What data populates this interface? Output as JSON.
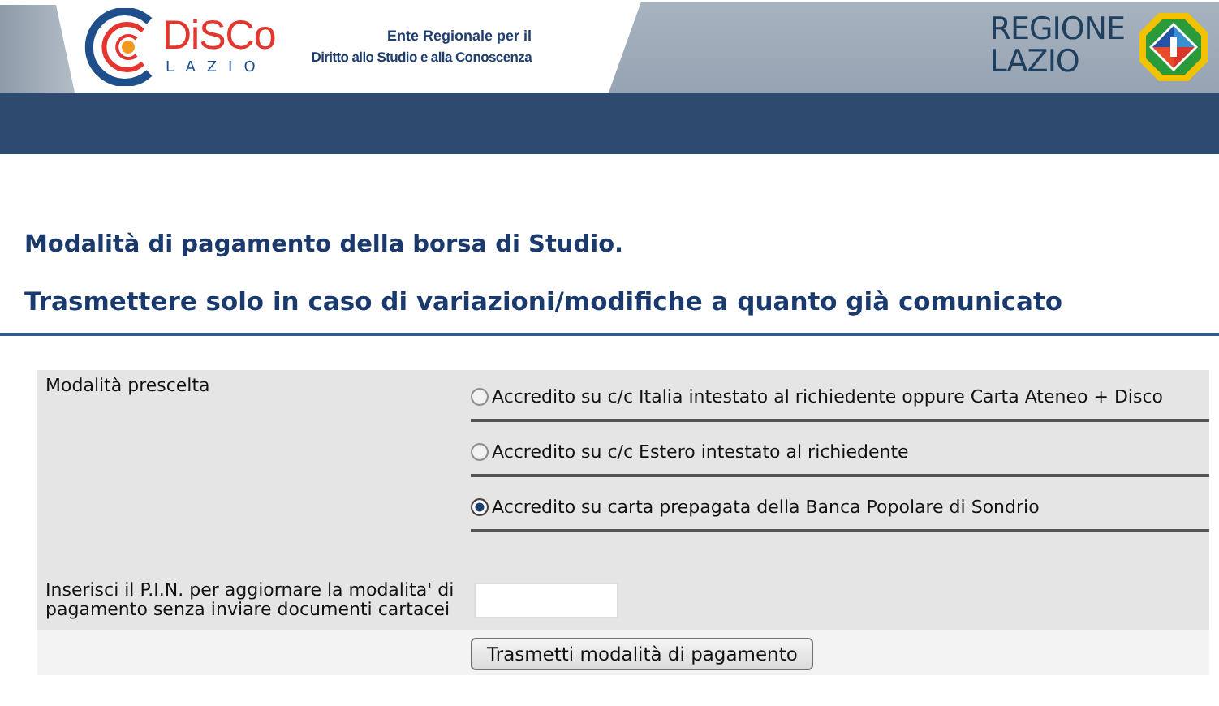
{
  "header": {
    "logo_name": "DiSCo",
    "logo_sub": "LAZIO",
    "tagline": "Ente Regionale per il",
    "tagline_2": "Diritto allo Studio e alla Conoscenza",
    "region": [
      "REGIONE",
      "LAZIO"
    ]
  },
  "titles": [
    "Modalità di pagamento della borsa di Studio.",
    "Trasmettere solo in caso di variazioni/modifiche a quanto già comunicato"
  ],
  "form": {
    "choice_label": "Modalità prescelta",
    "options": [
      {
        "label": "Accredito su c/c Italia intestato al richiedente oppure Carta Ateneo + Disco",
        "selected": false
      },
      {
        "label": "Accredito su c/c Estero intestato al richiedente",
        "selected": false
      },
      {
        "label": "Accredito su carta prepagata della Banca Popolare di Sondrio",
        "selected": true
      }
    ],
    "pin_label": "Inserisci il P.I.N. per aggiornare la modalita' di pagamento senza inviare documenti cartacei",
    "submit": "Trasmetti modalità di pagamento"
  }
}
